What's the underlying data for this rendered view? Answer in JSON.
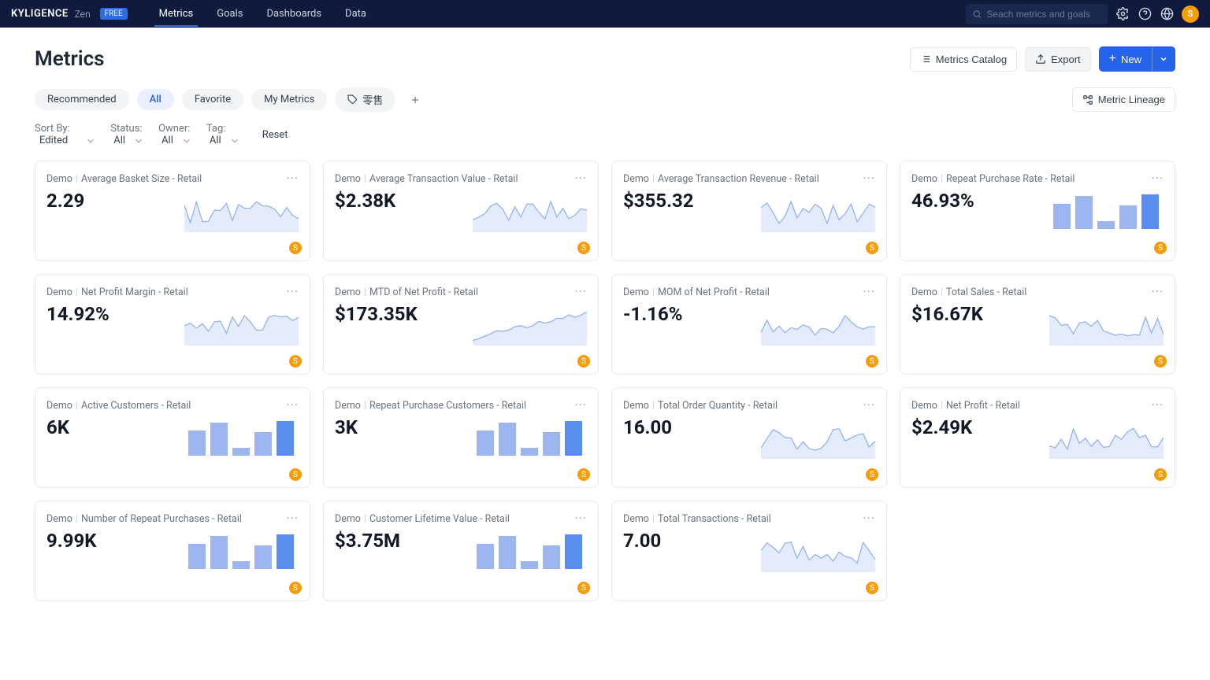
{
  "brand": {
    "name": "KYLIGENCE",
    "sub": "Zen",
    "badge": "FREE"
  },
  "nav": {
    "items": [
      "Metrics",
      "Goals",
      "Dashboards",
      "Data"
    ],
    "active": 0
  },
  "search": {
    "placeholder": "Seach metrics and goals"
  },
  "avatar": {
    "letter": "S"
  },
  "page_title": "Metrics",
  "header_buttons": {
    "catalog": "Metrics Catalog",
    "export": "Export",
    "new": "New"
  },
  "tabs": {
    "recommended": "Recommended",
    "all": "All",
    "favorite": "Favorite",
    "mymetrics": "My Metrics",
    "retail_zh": "零售"
  },
  "lineage_btn": "Metric Lineage",
  "filters": {
    "sort_by_label": "Sort By:",
    "sort_by_value": "Edited",
    "status_label": "Status:",
    "status_value": "All",
    "owner_label": "Owner:",
    "owner_value": "All",
    "tag_label": "Tag:",
    "tag_value": "All",
    "reset": "Reset"
  },
  "card_badge_letter": "S",
  "cards": [
    {
      "prefix": "Demo",
      "name": "Average Basket Size - Retail",
      "value": "2.29",
      "chart": "line"
    },
    {
      "prefix": "Demo",
      "name": "Average Transaction Value - Retail",
      "value": "$2.38K",
      "chart": "line"
    },
    {
      "prefix": "Demo",
      "name": "Average Transaction Revenue - Retail",
      "value": "$355.32",
      "chart": "line"
    },
    {
      "prefix": "Demo",
      "name": "Repeat Purchase Rate - Retail",
      "value": "46.93%",
      "chart": "bar"
    },
    {
      "prefix": "Demo",
      "name": "Net Profit Margin - Retail",
      "value": "14.92%",
      "chart": "line"
    },
    {
      "prefix": "Demo",
      "name": "MTD of Net Profit - Retail",
      "value": "$173.35K",
      "chart": "lineUp"
    },
    {
      "prefix": "Demo",
      "name": "MOM of Net Profit - Retail",
      "value": "-1.16%",
      "chart": "line"
    },
    {
      "prefix": "Demo",
      "name": "Total Sales - Retail",
      "value": "$16.67K",
      "chart": "line"
    },
    {
      "prefix": "Demo",
      "name": "Active Customers - Retail",
      "value": "6K",
      "chart": "bar"
    },
    {
      "prefix": "Demo",
      "name": "Repeat Purchase Customers - Retail",
      "value": "3K",
      "chart": "bar"
    },
    {
      "prefix": "Demo",
      "name": "Total Order Quantity - Retail",
      "value": "16.00",
      "chart": "line"
    },
    {
      "prefix": "Demo",
      "name": "Net Profit - Retail",
      "value": "$2.49K",
      "chart": "line"
    },
    {
      "prefix": "Demo",
      "name": "Number of Repeat Purchases - Retail",
      "value": "9.99K",
      "chart": "bar"
    },
    {
      "prefix": "Demo",
      "name": "Customer Lifetime Value - Retail",
      "value": "$3.75M",
      "chart": "bar"
    },
    {
      "prefix": "Demo",
      "name": "Total Transactions - Retail",
      "value": "7.00",
      "chart": "line"
    }
  ]
}
